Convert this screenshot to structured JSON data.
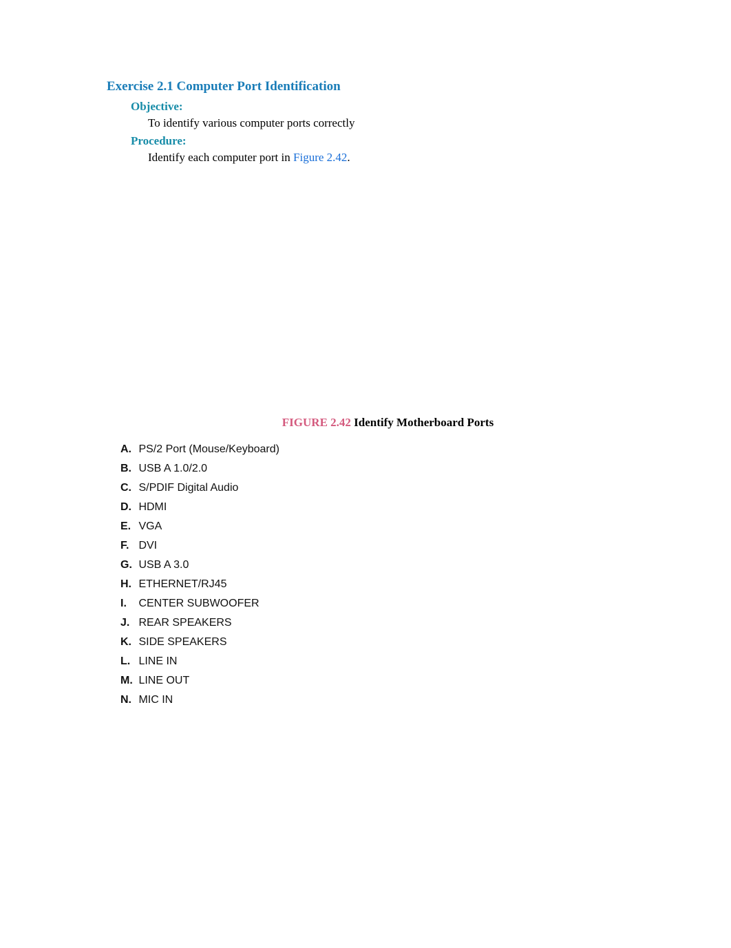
{
  "exercise": {
    "title": "Exercise 2.1 Computer Port Identification",
    "objective": {
      "label": "Objective:",
      "text": "To identify various computer ports correctly"
    },
    "procedure": {
      "label": "Procedure:",
      "prefix": "Identify each computer port in ",
      "link": "Figure 2.42",
      "suffix": "."
    }
  },
  "figure": {
    "label": "FIGURE 2.42",
    "title": " Identify Motherboard Ports"
  },
  "answers": [
    {
      "letter": "A.",
      "text": " PS/2 Port (Mouse/Keyboard)"
    },
    {
      "letter": "B.",
      "text": " USB A 1.0/2.0"
    },
    {
      "letter": "C.",
      "text": " S/PDIF Digital Audio"
    },
    {
      "letter": "D.",
      "text": " HDMI"
    },
    {
      "letter": "E.",
      "text": " VGA"
    },
    {
      "letter": "F.",
      "text": " DVI"
    },
    {
      "letter": "G.",
      "text": " USB A 3.0"
    },
    {
      "letter": "H.",
      "text": " ETHERNET/RJ45"
    },
    {
      "letter": "I.",
      "text": " CENTER SUBWOOFER"
    },
    {
      "letter": "J.",
      "text": " REAR SPEAKERS"
    },
    {
      "letter": "K.",
      "text": " SIDE SPEAKERS"
    },
    {
      "letter": "L.",
      "text": " LINE IN"
    },
    {
      "letter": "M.",
      "text": " LINE OUT"
    },
    {
      "letter": "N.",
      "text": " MIC IN"
    }
  ]
}
